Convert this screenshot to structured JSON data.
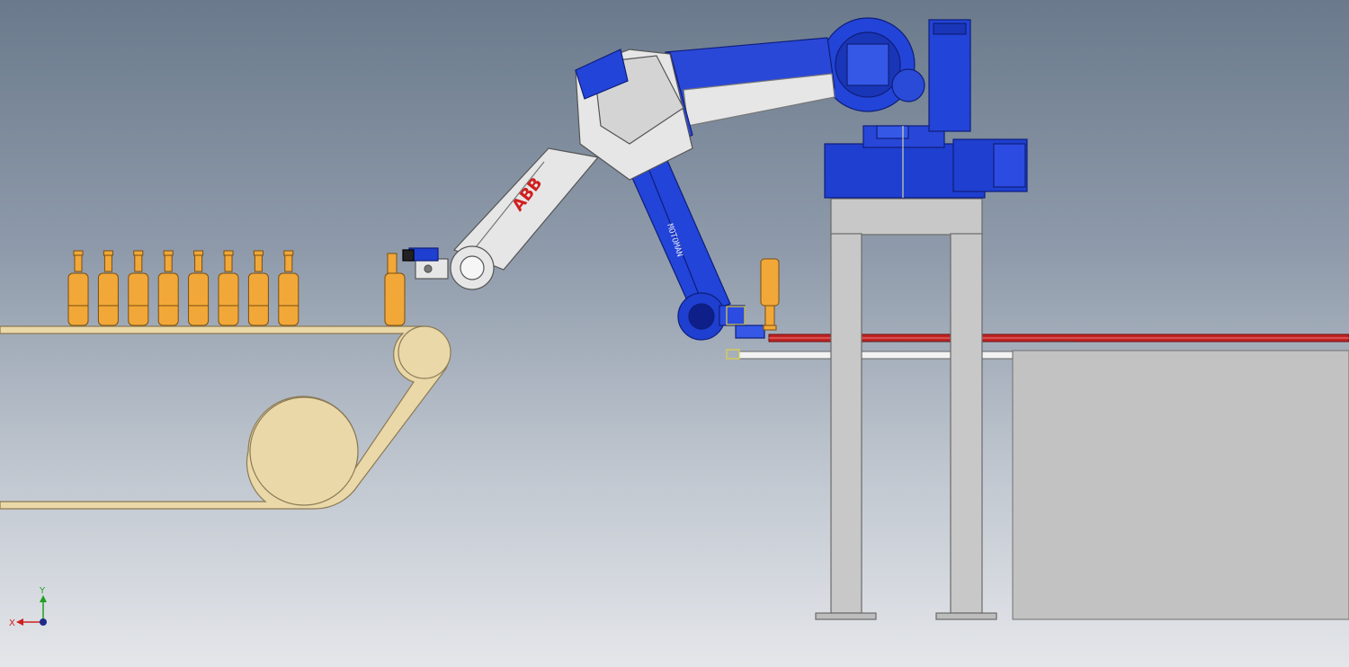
{
  "viewport": {
    "background_top": "#6a7a8c",
    "background_bottom": "#e4e6ea"
  },
  "robot_left": {
    "brand_label": "ABB",
    "color": "#e6e6e6",
    "accent": "#d01e1e"
  },
  "robot_right": {
    "arm_label": "MOTOMAN",
    "color": "#1e3fd0"
  },
  "conveyor": {
    "belt_color": "#ead8a8",
    "bottle_color": "#f2a838",
    "bottle_count": 8
  },
  "axis_triad": {
    "x_label": "X",
    "y_label": "Y",
    "x_color": "#d02020",
    "y_color": "#20a020"
  }
}
